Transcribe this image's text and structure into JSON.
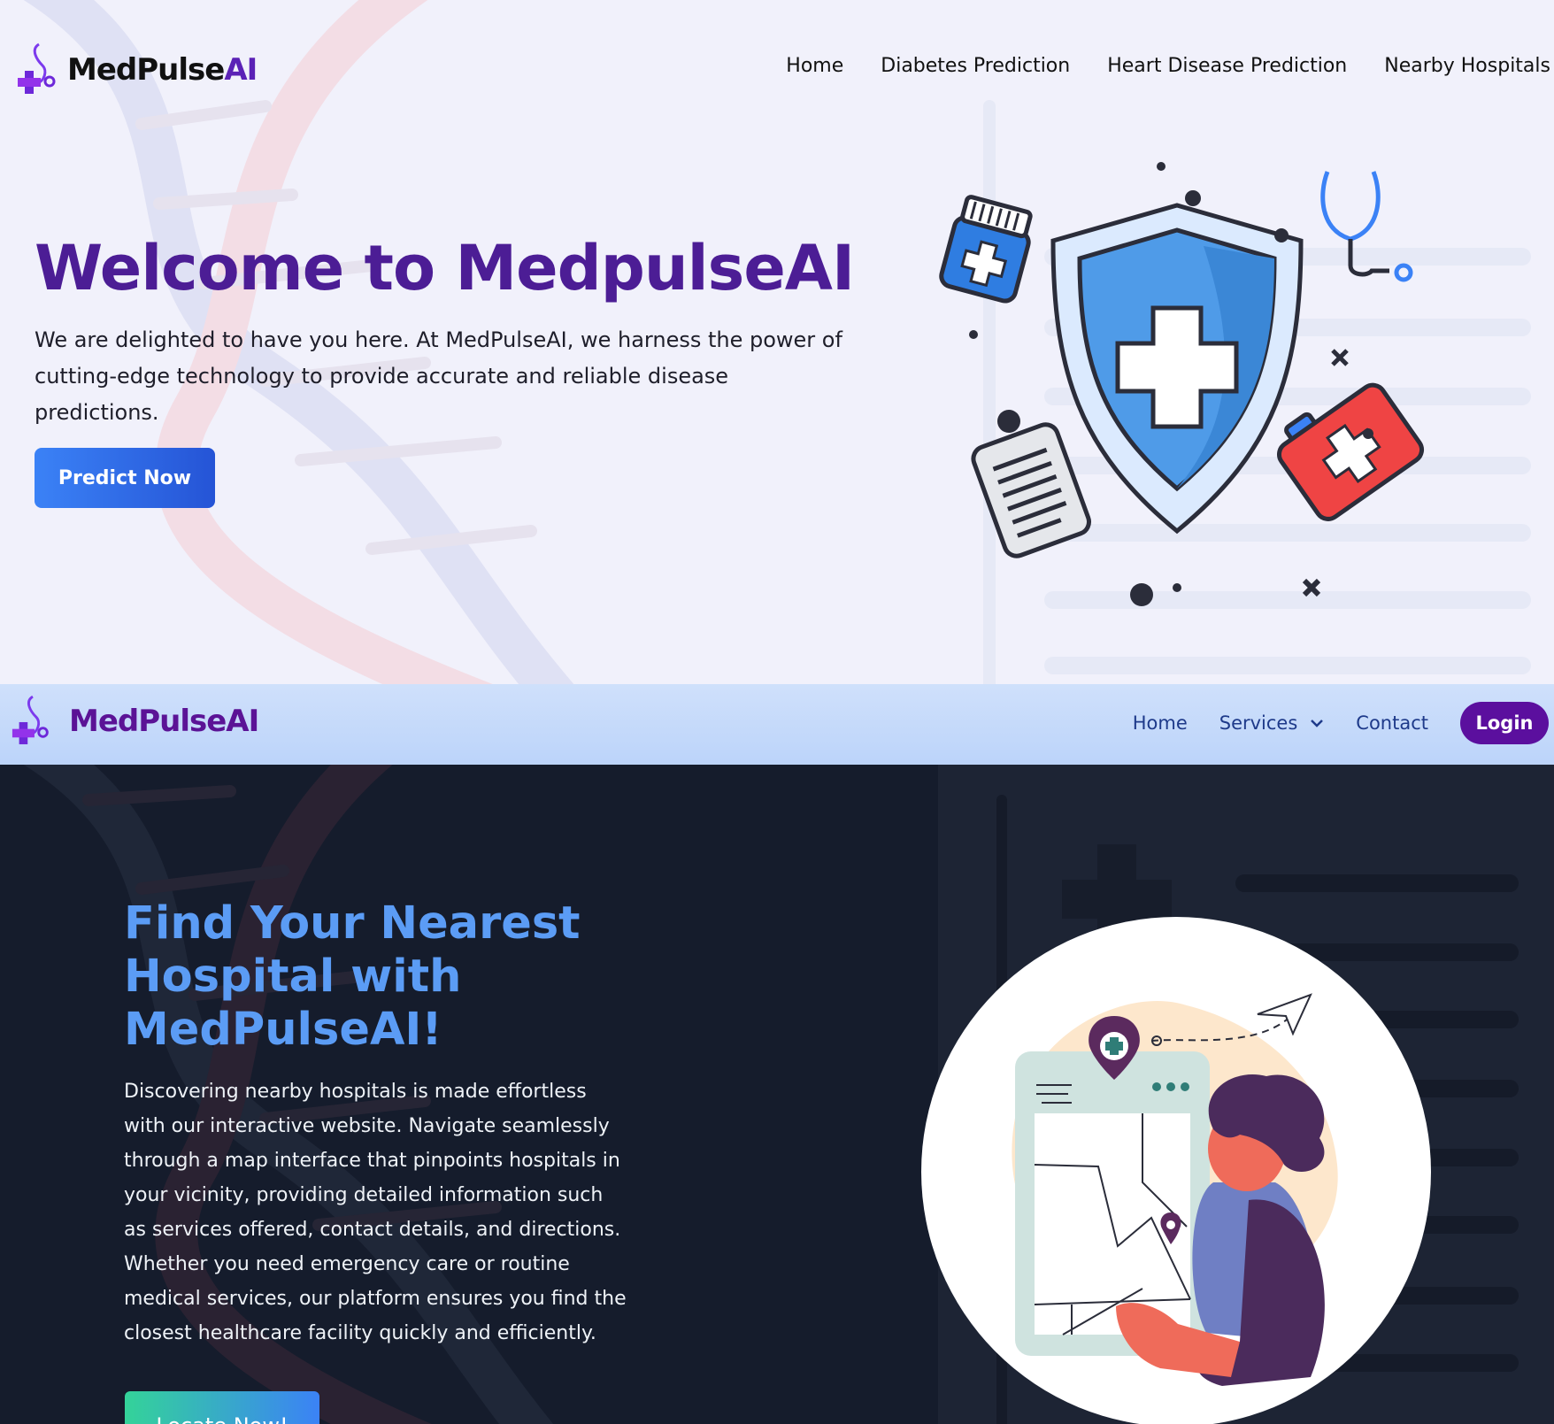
{
  "section1": {
    "brand_main": "MedPulse",
    "brand_ai": "AI",
    "nav": [
      "Home",
      "Diabetes Prediction",
      "Heart Disease Prediction",
      "Nearby Hospitals"
    ],
    "title": "Welcome to MedpulseAI",
    "intro": "We are delighted to have you here. At MedPulseAI, we harness the power of cutting-edge technology to provide accurate and reliable disease predictions.",
    "cta": "Predict Now"
  },
  "navbar2": {
    "brand": "MedPulseAI",
    "home": "Home",
    "services": "Services",
    "contact": "Contact",
    "login": "Login"
  },
  "section2": {
    "title": "Find Your Nearest Hospital with MedPulseAI!",
    "description": "Discovering nearby hospitals is made effortless with our interactive website. Navigate seamlessly through a map interface that pinpoints hospitals in your vicinity, providing detailed information such as services offered, contact details, and directions. Whether you need emergency care or routine medical services, our platform ensures you find the closest healthcare facility quickly and efficiently.",
    "cta": "Locate Now!"
  },
  "colors": {
    "brand_purple": "#5b21b6",
    "heading_purple": "#4c1d95",
    "login_purple": "#5b0f9e",
    "accent_blue": "#3b82f6",
    "dark_bg": "#151c2c",
    "light_bg": "#f1f1fb",
    "nav2_bg": "#c7dbfb"
  },
  "icons": [
    "medpulse-logo-icon",
    "chevron-down-icon",
    "shield-cross-icon",
    "stethoscope-icon",
    "pill-bottle-icon",
    "first-aid-kit-icon",
    "clipboard-icon",
    "map-pin-icon",
    "paper-plane-icon"
  ]
}
